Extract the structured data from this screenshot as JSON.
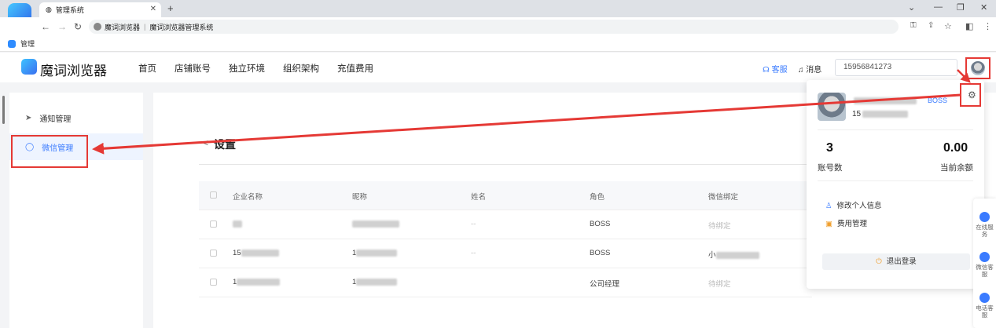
{
  "browser": {
    "tab_title": "管理系统",
    "tab_close": "✕",
    "new_tab": "+",
    "address_site": "魔词浏览器",
    "address_separator": "|",
    "address_page": "魔词浏览器管理系统",
    "bookmark": "管理"
  },
  "app": {
    "logo_text": "魔词浏览器",
    "menu": [
      "首页",
      "店铺账号",
      "独立环境",
      "组织架构",
      "充值费用"
    ],
    "kefu": "客服",
    "message": "消息",
    "phone_select": "15956841273",
    "accent": "#3a7bff"
  },
  "sidebar": {
    "items": [
      "通知管理",
      "微信管理"
    ],
    "active": "微信管理"
  },
  "main": {
    "back": "<",
    "title": "设置",
    "table": {
      "headers": [
        "企业名称",
        "昵称",
        "姓名",
        "角色",
        "微信绑定"
      ],
      "rows": [
        {
          "company": "",
          "nickname": "",
          "name": "--",
          "role": "BOSS",
          "wechat": "待绑定"
        },
        {
          "company": "15",
          "nickname": "1",
          "name": "--",
          "role": "BOSS",
          "wechat": "小"
        },
        {
          "company": "1",
          "nickname": "1",
          "name": "",
          "role": "公司经理",
          "wechat": "待绑定"
        }
      ]
    }
  },
  "dropdown": {
    "role": "BOSS",
    "phone": "15",
    "accounts_value": "3",
    "accounts_label": "账号数",
    "balance_value": "0.00",
    "balance_label": "当前余额",
    "edit_profile": "修改个人信息",
    "fee_manage": "费用管理",
    "logout": "退出登录"
  },
  "float_panel": {
    "items": [
      "在线服务",
      "微信客服",
      "电话客服"
    ]
  }
}
